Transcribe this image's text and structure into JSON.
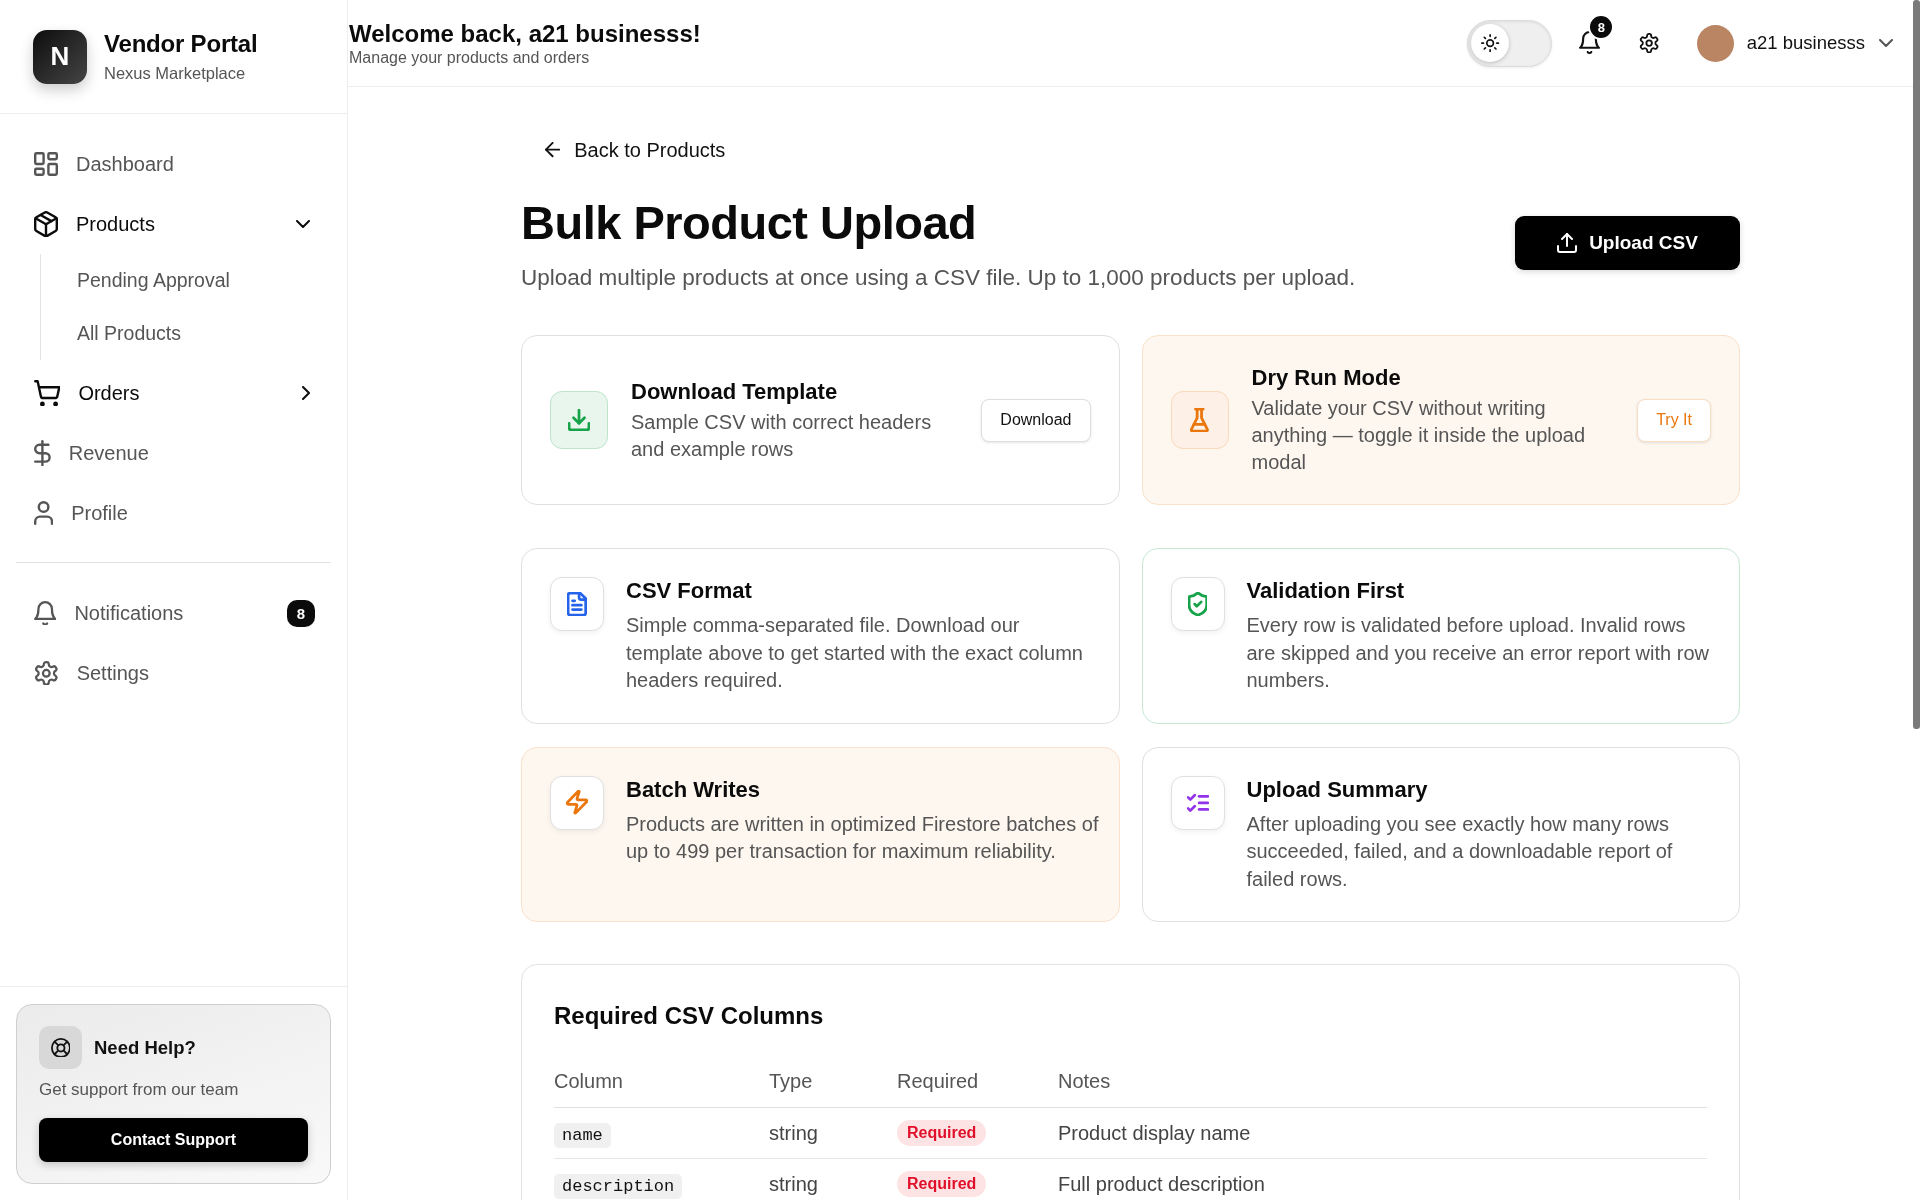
{
  "sidebar": {
    "brand": {
      "logo": "N",
      "title": "Vendor Portal",
      "subtitle": "Nexus Marketplace"
    },
    "nav": [
      {
        "kind": "link",
        "label": "Dashboard"
      },
      {
        "kind": "group",
        "label": "Products",
        "expanded": true,
        "children": [
          {
            "label": "Pending Approval"
          },
          {
            "label": "All Products"
          }
        ]
      },
      {
        "kind": "group",
        "label": "Orders",
        "expanded": false
      },
      {
        "kind": "link",
        "label": "Revenue"
      },
      {
        "kind": "link",
        "label": "Profile"
      }
    ],
    "secondary_nav": [
      {
        "label": "Notifications",
        "badge": "8"
      },
      {
        "label": "Settings"
      }
    ],
    "help_card": {
      "title": "Need Help?",
      "text": "Get support from our team",
      "button": "Contact Support"
    }
  },
  "header": {
    "title": "Welcome back, a21 businesss!",
    "subtitle": "Manage your products and orders",
    "dark_mode": false,
    "notification_count": "8",
    "user_name": "a21 businesss"
  },
  "page": {
    "back_link": "Back to Products",
    "title": "Bulk Product Upload",
    "subtitle": "Upload multiple products at once using a CSV file. Up to 1,000 products per upload.",
    "upload_button": "Upload CSV"
  },
  "action_cards": [
    {
      "kind": "plain",
      "color": "#16a34a",
      "title": "Download Template",
      "text": "Sample CSV with correct headers and example rows",
      "button": "Download"
    },
    {
      "kind": "tinted",
      "color": "#ea760c",
      "title": "Dry Run Mode",
      "text": "Validate your CSV without writing anything — toggle it inside the upload modal",
      "button": "Try It"
    }
  ],
  "info_cards": [
    {
      "kind": "plain",
      "color": "#2563eb",
      "title": "CSV Format",
      "text": "Simple comma-separated file. Download our template above to get started with the exact column headers required."
    },
    {
      "kind": "outlined",
      "color": "#16a34a",
      "title": "Validation First",
      "text": "Every row is validated before upload. Invalid rows are skipped and you receive an error report with row numbers."
    },
    {
      "kind": "tinted",
      "color": "#ea760c",
      "title": "Batch Writes",
      "text": "Products are written in optimized Firestore batches of up to 499 per transaction for maximum reliability."
    },
    {
      "kind": "plain",
      "color": "#9333ea",
      "title": "Upload Summary",
      "text": "After uploading you see exactly how many rows succeeded, failed, and a downloadable report of failed rows."
    }
  ],
  "columns_table": {
    "title": "Required CSV Columns",
    "columns": [
      "Column",
      "Type",
      "Required",
      "Notes"
    ],
    "rows": [
      {
        "column": "name",
        "type": "string",
        "required": "Required",
        "notes": "Product display name"
      },
      {
        "column": "description",
        "type": "string",
        "required": "Required",
        "notes": "Full product description"
      }
    ]
  }
}
